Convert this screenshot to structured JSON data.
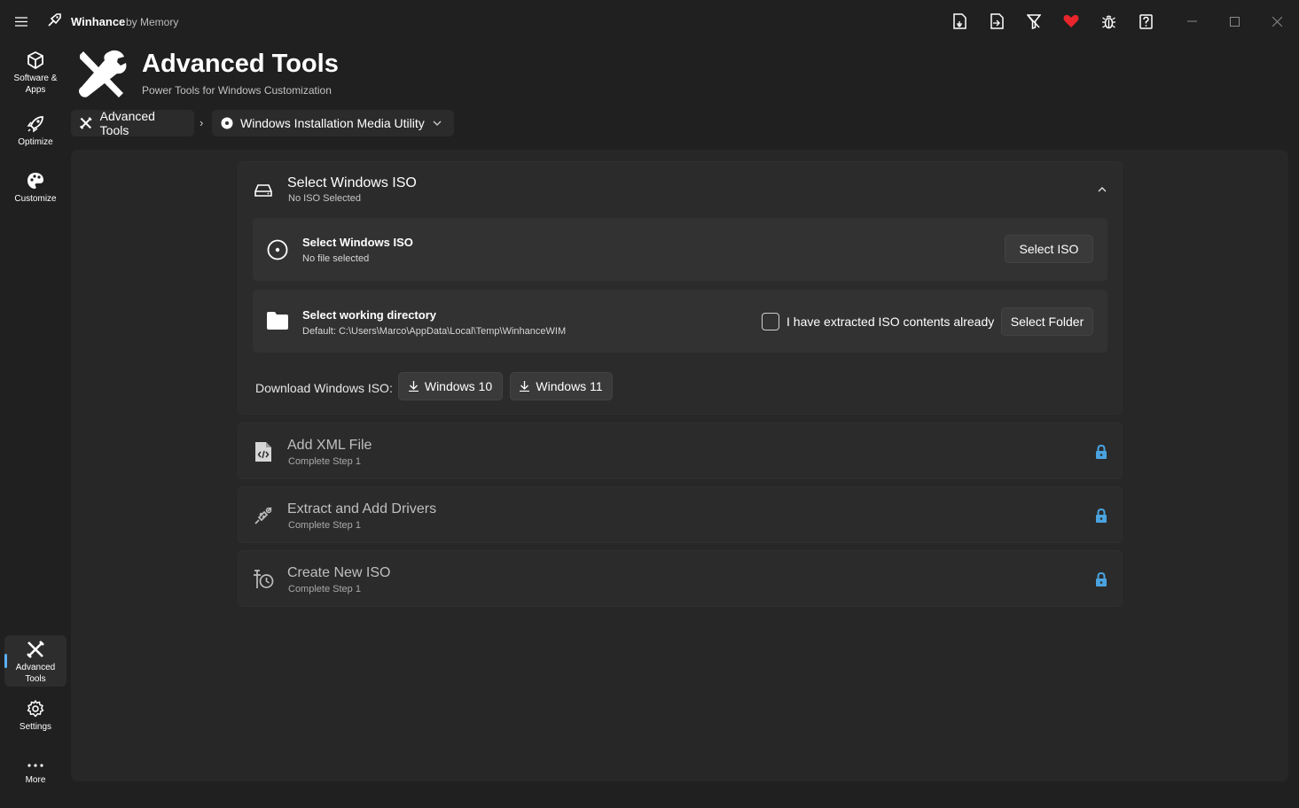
{
  "titlebar": {
    "app_name": "Winhance",
    "app_by": "by Memory",
    "icons": [
      "export-config-icon",
      "import-config-icon",
      "filter-icon",
      "heart-icon",
      "bug-icon",
      "help-icon"
    ],
    "heart_color": "#e8262b"
  },
  "nav": {
    "items": [
      {
        "label": "Software &\nApps",
        "icon": "cube-icon"
      },
      {
        "label": "Optimize",
        "icon": "rocket-icon"
      },
      {
        "label": "Customize",
        "icon": "palette-icon"
      },
      {
        "label": "Advanced\nTools",
        "icon": "tools-icon",
        "active": true
      },
      {
        "label": "Settings",
        "icon": "gear-icon"
      },
      {
        "label": "More",
        "icon": "more-icon"
      }
    ],
    "accent": "#5ab0f5"
  },
  "header": {
    "title": "Advanced Tools",
    "subtitle": "Power Tools for Windows Customization"
  },
  "breadcrumb": {
    "root": "Advanced Tools",
    "current": "Windows Installation Media Utility"
  },
  "step1": {
    "title": "Select Windows ISO",
    "subtitle": "No ISO Selected",
    "iso_row": {
      "title": "Select Windows ISO",
      "subtitle": "No file selected",
      "button": "Select ISO"
    },
    "dir_row": {
      "title": "Select working directory",
      "subtitle": "Default: C:\\Users\\Marco\\AppData\\Local\\Temp\\WinhanceWIM",
      "checkbox_label": "I have extracted ISO contents already",
      "checkbox_checked": false,
      "button": "Select Folder"
    },
    "download": {
      "label": "Download Windows ISO:",
      "win10": "Windows 10",
      "win11": "Windows 11"
    }
  },
  "steps_locked": [
    {
      "title": "Add XML File",
      "subtitle": "Complete Step 1",
      "icon": "xml-file-icon"
    },
    {
      "title": "Extract and Add Drivers",
      "subtitle": "Complete Step 1",
      "icon": "driver-icon"
    },
    {
      "title": "Create New ISO",
      "subtitle": "Complete Step 1",
      "icon": "create-iso-icon"
    }
  ],
  "lock_color": "#4aa3df"
}
